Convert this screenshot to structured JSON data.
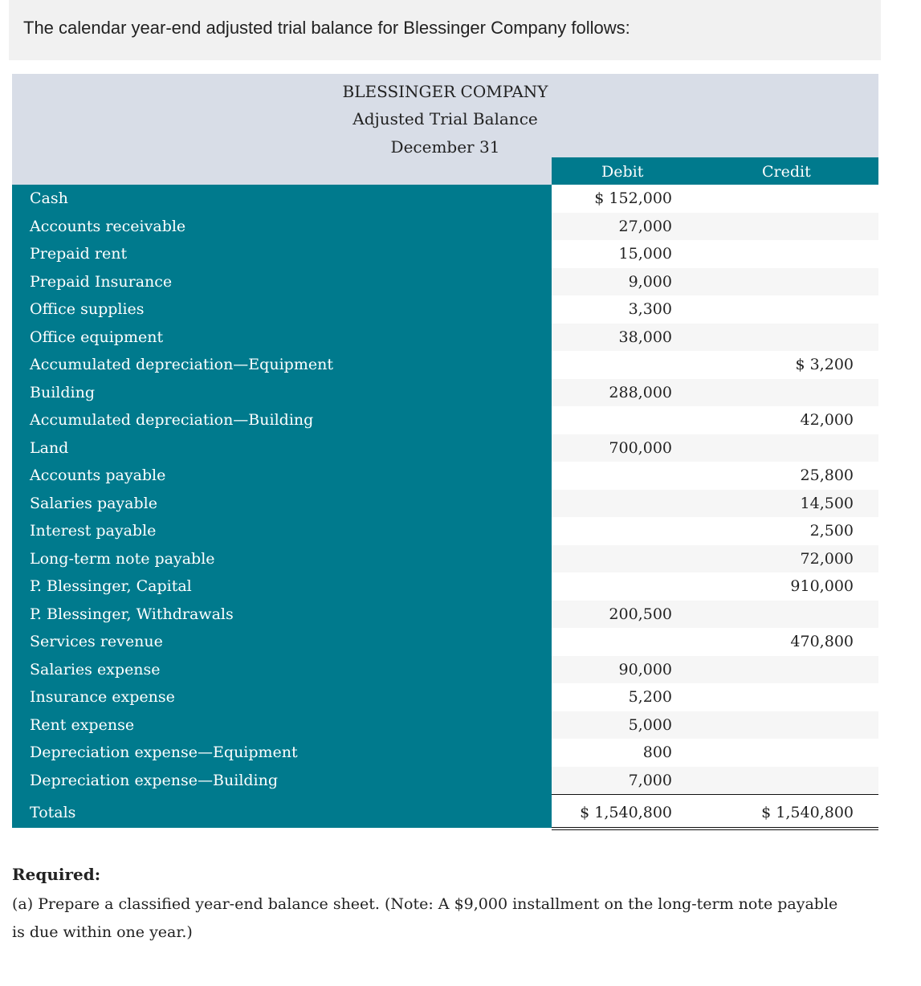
{
  "intro": "The calendar year-end adjusted trial balance for Blessinger Company follows:",
  "statement": {
    "company": "BLESSINGER COMPANY",
    "title": "Adjusted Trial Balance",
    "date": "December 31",
    "columns": {
      "debit": "Debit",
      "credit": "Credit"
    },
    "rows": [
      {
        "account": "Cash",
        "debit": "$ 152,000",
        "credit": ""
      },
      {
        "account": "Accounts receivable",
        "debit": "27,000",
        "credit": ""
      },
      {
        "account": "Prepaid rent",
        "debit": "15,000",
        "credit": ""
      },
      {
        "account": "Prepaid Insurance",
        "debit": "9,000",
        "credit": ""
      },
      {
        "account": "Office supplies",
        "debit": "3,300",
        "credit": ""
      },
      {
        "account": "Office equipment",
        "debit": "38,000",
        "credit": ""
      },
      {
        "account": "Accumulated depreciation—Equipment",
        "debit": "",
        "credit": "$ 3,200"
      },
      {
        "account": "Building",
        "debit": "288,000",
        "credit": ""
      },
      {
        "account": "Accumulated depreciation—Building",
        "debit": "",
        "credit": "42,000"
      },
      {
        "account": "Land",
        "debit": "700,000",
        "credit": ""
      },
      {
        "account": "Accounts payable",
        "debit": "",
        "credit": "25,800"
      },
      {
        "account": "Salaries payable",
        "debit": "",
        "credit": "14,500"
      },
      {
        "account": "Interest payable",
        "debit": "",
        "credit": "2,500"
      },
      {
        "account": "Long-term note payable",
        "debit": "",
        "credit": "72,000"
      },
      {
        "account": "P. Blessinger, Capital",
        "debit": "",
        "credit": "910,000"
      },
      {
        "account": "P. Blessinger, Withdrawals",
        "debit": "200,500",
        "credit": ""
      },
      {
        "account": "Services revenue",
        "debit": "",
        "credit": "470,800"
      },
      {
        "account": "Salaries expense",
        "debit": "90,000",
        "credit": ""
      },
      {
        "account": "Insurance expense",
        "debit": "5,200",
        "credit": ""
      },
      {
        "account": "Rent expense",
        "debit": "5,000",
        "credit": ""
      },
      {
        "account": "Depreciation expense—Equipment",
        "debit": "800",
        "credit": ""
      },
      {
        "account": "Depreciation expense—Building",
        "debit": "7,000",
        "credit": ""
      }
    ],
    "totals": {
      "label": "Totals",
      "debit": "$ 1,540,800",
      "credit": "$ 1,540,800"
    }
  },
  "required": {
    "heading": "Required:",
    "text": "(a) Prepare a classified year-end balance sheet. (Note: A $9,000 installment on the long-term note payable is due within one year.)"
  }
}
